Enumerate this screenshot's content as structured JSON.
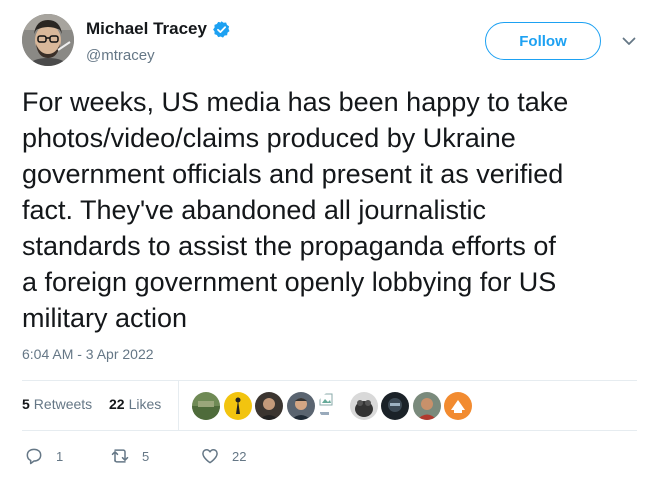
{
  "tweet": {
    "author": {
      "display_name": "Michael Tracey",
      "handle": "@mtracey",
      "verified": true
    },
    "follow_label": "Follow",
    "text_lines": [
      "For weeks, US media has been happy to take",
      "photos/video/claims produced by Ukraine",
      "government officials and present it as verified",
      "fact. They've abandoned all journalistic",
      "standards to assist the propaganda efforts of",
      "a foreign government openly lobbying for US",
      "military action"
    ],
    "timestamp": "6:04 AM - 3 Apr 2022",
    "stats": {
      "retweets_count": "5",
      "retweets_label": "Retweets",
      "likes_count": "22",
      "likes_label": "Likes"
    },
    "actions": {
      "reply_count": "1",
      "retweet_count": "5",
      "like_count": "22"
    }
  },
  "colors": {
    "accent": "#1da1f2",
    "secondary_text": "#657786",
    "divider": "#e6ecf0"
  }
}
